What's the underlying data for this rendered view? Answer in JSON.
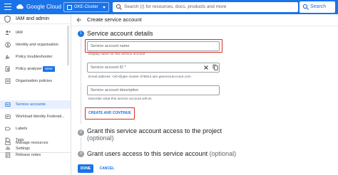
{
  "topbar": {
    "brand": "Google Cloud",
    "project": "GKE-Cluster",
    "search_placeholder": "Search (/) for resources, docs, products and more",
    "search_button": "Search"
  },
  "sidebar": {
    "title": "IAM and admin",
    "items": [
      {
        "label": "IAM",
        "icon": "person-add-icon"
      },
      {
        "label": "Identity and organisation",
        "icon": "person-circle-icon"
      },
      {
        "label": "Policy troubleshooter",
        "icon": "wrench-icon"
      },
      {
        "label": "Policy analyser",
        "icon": "search-doc-icon",
        "badge": "NEW"
      },
      {
        "label": "Organisation policies",
        "icon": "list-doc-icon"
      },
      {
        "label": "Service accounts",
        "icon": "service-account-icon",
        "active": true
      },
      {
        "label": "Workload Identity Federati...",
        "icon": "id-card-icon"
      },
      {
        "label": "Labels",
        "icon": "label-icon"
      },
      {
        "label": "Tags",
        "icon": "tag-icon"
      },
      {
        "label": "Settings",
        "icon": "gear-icon"
      }
    ],
    "footer": [
      {
        "label": "Manage resources",
        "icon": "folder-icon"
      },
      {
        "label": "Release notes",
        "icon": "notes-icon"
      }
    ]
  },
  "page": {
    "title": "Create service account"
  },
  "steps": [
    {
      "number": "1",
      "title": "Service account details",
      "optional": ""
    },
    {
      "number": "2",
      "title": "Grant this service account access to the project",
      "optional": "(optional)"
    },
    {
      "number": "3",
      "title": "Grant users access to this service account",
      "optional": "(optional)"
    }
  ],
  "form": {
    "name_placeholder": "Service account name",
    "name_helper": "Display name for this service account",
    "id_placeholder": "Service account ID *",
    "email": "Email address: <id>@gke-cluster-378814.iam.gserviceaccount.com",
    "description_placeholder": "Service account description",
    "description_helper": "Describe what this service account will do",
    "create_button": "CREATE AND CONTINUE"
  },
  "actions": {
    "done": "DONE",
    "cancel": "CANCEL"
  },
  "colors": {
    "primary": "#1a73e8",
    "highlight": "#d93025",
    "active_bg": "#e8f0fe"
  }
}
